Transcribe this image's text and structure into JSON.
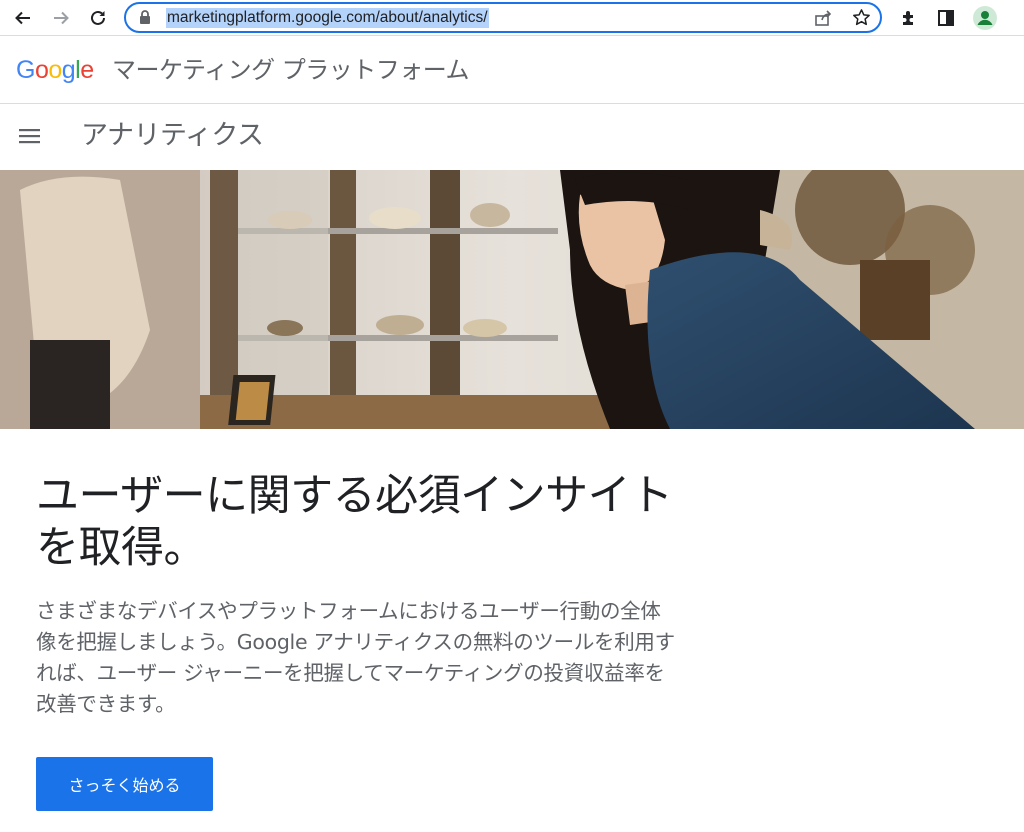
{
  "browser": {
    "url": "marketingplatform.google.com/about/analytics/",
    "icons": [
      "back-icon",
      "forward-icon",
      "reload-icon",
      "lock-icon",
      "share-icon",
      "star-icon",
      "extensions-icon",
      "side-panel-icon",
      "profile-icon"
    ]
  },
  "header": {
    "logo": "Google",
    "product": "マーケティング プラットフォーム"
  },
  "subnav": {
    "title": "アナリティクス"
  },
  "main": {
    "headline": "ユーザーに関する必須インサイトを取得。",
    "description": "さまざまなデバイスやプラットフォームにおけるユーザー行動の全体像を把握しましょう。Google アナリティクスの無料のツールを利用すれば、ユーザー ジャーニーを把握してマーケティングの投資収益率を改善できます。",
    "cta_label": "さっそく始める"
  },
  "colors": {
    "accent": "#1a73e8",
    "google_blue": "#4285f4",
    "google_red": "#ea4335",
    "google_yellow": "#fbbc05",
    "google_green": "#34a853"
  }
}
